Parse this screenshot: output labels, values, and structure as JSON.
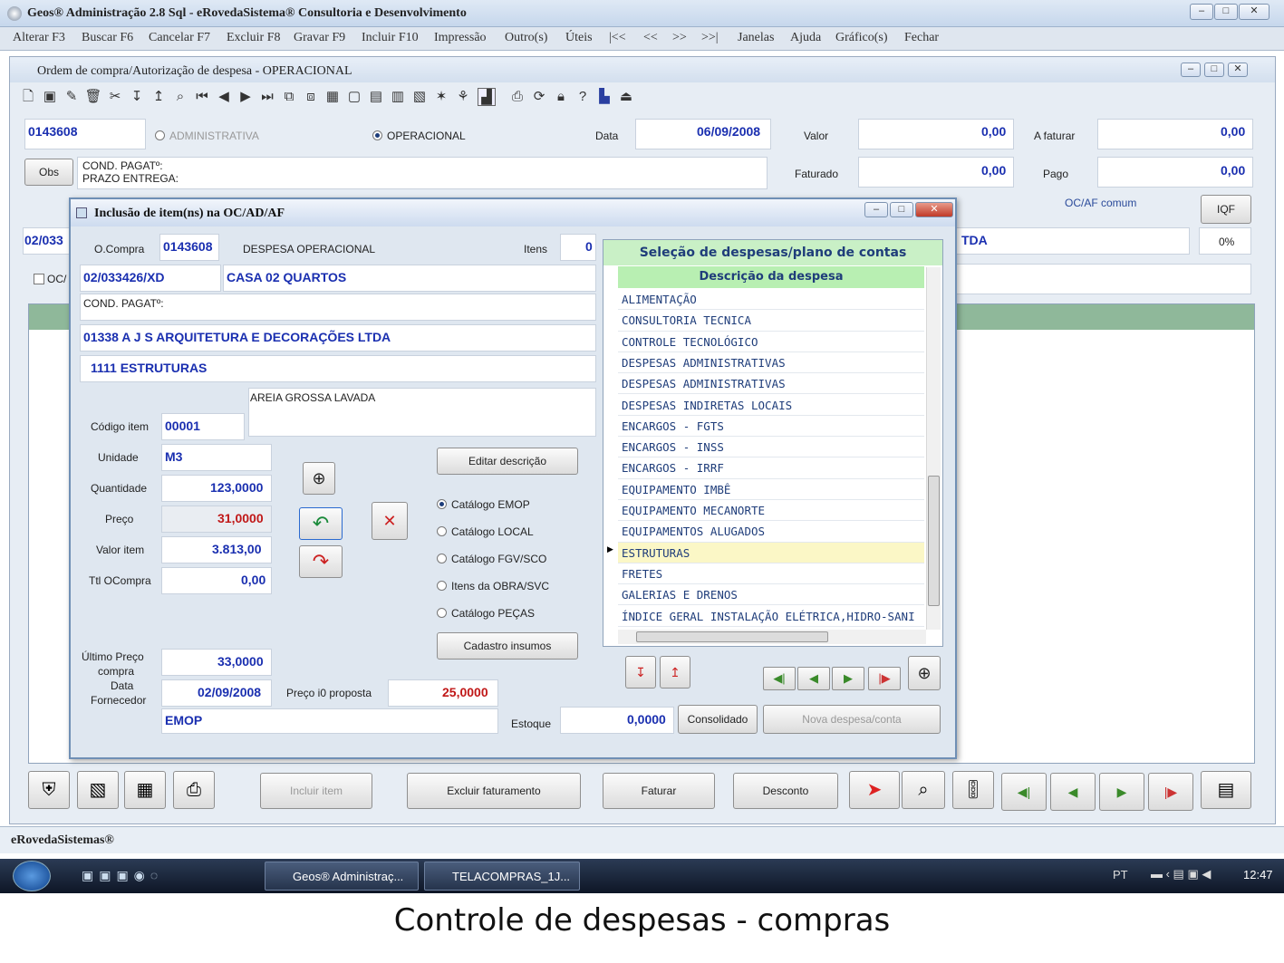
{
  "app": {
    "title": "Geos® Administração 2.8 Sql - eRovedaSistema® Consultoria e Desenvolvimento"
  },
  "menu": [
    "Alterar F3",
    "Buscar F6",
    "Cancelar F7",
    "Excluir F8",
    "Gravar F9",
    "Incluir F10",
    "Impressão",
    "Outro(s)",
    "Úteis",
    "|<<",
    "<<",
    ">>",
    ">>|",
    "Janelas",
    "Ajuda",
    "Gráfico(s)",
    "Fechar"
  ],
  "form": {
    "title": "Ordem de compra/Autorização de despesa - OPERACIONAL",
    "number": "0143608",
    "radio_admin": "ADMINISTRATIVA",
    "radio_oper": "OPERACIONAL",
    "data_label": "Data",
    "data_value": "06/09/2008",
    "valor_label": "Valor",
    "valor_value": "0,00",
    "afaturar_label": "A faturar",
    "afaturar_value": "0,00",
    "obs_button": "Obs",
    "obs_text1": "COND. PAGATº:",
    "obs_text2": "PRAZO ENTREGA:",
    "faturado_label": "Faturado",
    "faturado_value": "0,00",
    "pago_label": "Pago",
    "pago_value": "0,00",
    "ocaf_label": "OC/AF comum",
    "iqf_button": "IQF",
    "left_code": "02/033",
    "left_oc": "OC/",
    "tda": "TDA",
    "percent": "0%"
  },
  "dialog": {
    "title": "Inclusão de item(ns) na OC/AD/AF",
    "ocompra_label": "O.Compra",
    "ocompra_value": "0143608",
    "despesa_op": "DESPESA OPERACIONAL",
    "itens_label": "Itens",
    "itens_value": "0",
    "obra_code": "02/033426/XD",
    "obra_name": "CASA 02 QUARTOS",
    "cond_pagat": "COND. PAGATº:",
    "fornecedor": "01338 A J S ARQUITETURA E DECORAÇÕES LTDA",
    "conta": "1111  ESTRUTURAS",
    "desc_item": "AREIA GROSSA LAVADA",
    "codigo_label": "Código item",
    "codigo_value": "00001",
    "unidade_label": "Unidade",
    "unidade_value": "M3",
    "quantidade_label": "Quantidade",
    "quantidade_value": "123,0000",
    "preco_label": "Preço",
    "preco_value": "31,0000",
    "valor_item_label": "Valor item",
    "valor_item_value": "3.813,00",
    "ttl_label": "Ttl OCompra",
    "ttl_value": "0,00",
    "ultimo_label1": "Último Preço",
    "ultimo_label2": "compra",
    "ultimo_value": "33,0000",
    "data_label": "Data",
    "fornecedor_label": "Fornecedor",
    "data_value": "02/09/2008",
    "preco_proposta_label": "Preço i0 proposta",
    "preco_proposta_value": "25,0000",
    "fonte": "EMOP",
    "estoque_label": "Estoque",
    "estoque_value": "0,0000",
    "consolidado_button": "Consolidado",
    "nova_despesa_button": "Nova despesa/conta",
    "editar_button": "Editar descrição",
    "cadastro_button": "Cadastro insumos",
    "catalogs": [
      "Catálogo EMOP",
      "Catálogo LOCAL",
      "Catálogo FGV/SCO",
      "Itens da OBRA/SVC",
      "Catálogo PEÇAS"
    ],
    "grid_title": "Seleção de despesas/plano de contas",
    "grid_col": "Descrição da despesa",
    "grid_rows": [
      "ALIMENTAÇÃO",
      "CONSULTORIA TECNICA",
      "CONTROLE TECNOLÓGICO",
      "DESPESAS ADMINISTRATIVAS",
      "DESPESAS ADMINISTRATIVAS",
      "DESPESAS INDIRETAS LOCAIS",
      "ENCARGOS - FGTS",
      "ENCARGOS - INSS",
      "ENCARGOS - IRRF",
      "EQUIPAMENTO IMBÊ",
      "EQUIPAMENTO MECANORTE",
      "EQUIPAMENTOS ALUGADOS",
      "ESTRUTURAS",
      "FRETES",
      "GALERIAS E DRENOS",
      "ÍNDICE GERAL INSTALAÇÃO ELÉTRICA,HIDRO-SANI"
    ],
    "selected_row": "ESTRUTURAS"
  },
  "bottom": {
    "incluir": "Incluir item",
    "excluir": "Excluir faturamento",
    "faturar": "Faturar",
    "desconto": "Desconto"
  },
  "status": "eRovedaSistemas®",
  "taskbar": {
    "item1": "Geos® Administraç...",
    "item2": "TELACOMPRAS_1J...",
    "lang": "PT",
    "time": "12:47"
  },
  "caption": "Controle de despesas - compras"
}
